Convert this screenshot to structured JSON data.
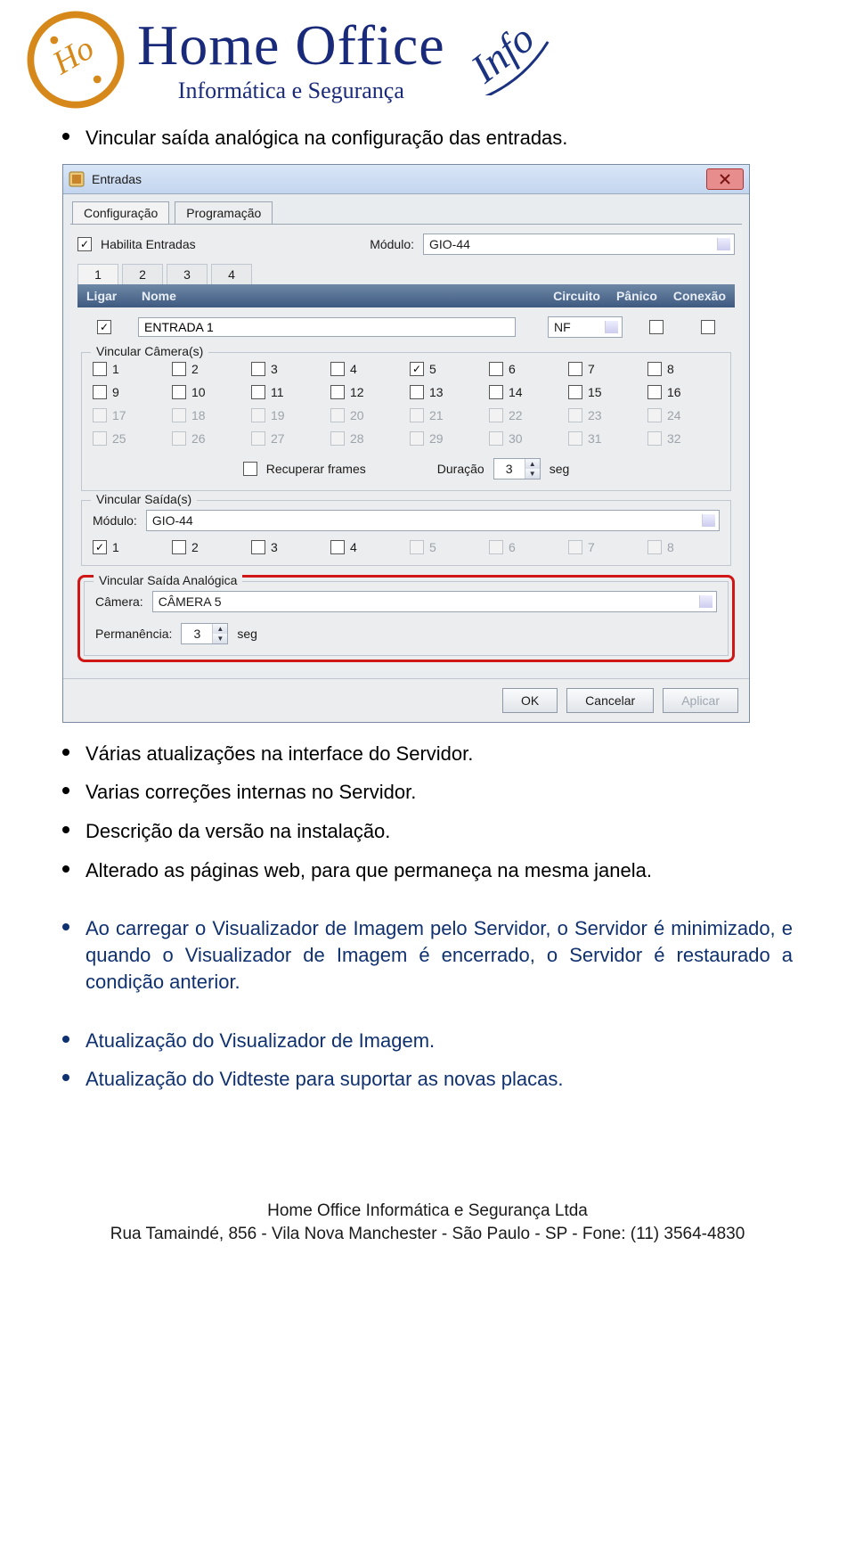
{
  "brand": {
    "main": "Home Office",
    "sub": "Informática e Segurança",
    "script": "Info"
  },
  "bullets": {
    "b0": "Vincular saída analógica na configuração das entradas.",
    "b1": "Várias atualizações na interface do Servidor.",
    "b2": "Varias correções internas no Servidor.",
    "b3": "Descrição da versão na instalação.",
    "b4": "Alterado as páginas web, para que permaneça na mesma janela.",
    "b5": "Ao carregar o Visualizador de Imagem pelo Servidor, o Servidor é minimizado, e quando o Visualizador de Imagem é encerrado, o Servidor é restaurado a condição anterior.",
    "b6": "Atualização do Visualizador de Imagem.",
    "b7": "Atualização do Vidteste para suportar as novas placas."
  },
  "win": {
    "title": "Entradas",
    "tabs": {
      "config": "Configuração",
      "prog": "Programação"
    },
    "habilita": "Habilita Entradas",
    "modulo_label": "Módulo:",
    "modulo_value": "GIO-44",
    "small_tabs": [
      "1",
      "2",
      "3",
      "4"
    ],
    "cols": {
      "ligar": "Ligar",
      "nome": "Nome",
      "circuito": "Circuito",
      "panico": "Pânico",
      "conexao": "Conexão"
    },
    "entry_name": "ENTRADA 1",
    "nf": "NF",
    "vcam": {
      "legend": "Vincular Câmera(s)",
      "nums": [
        "1",
        "2",
        "3",
        "4",
        "5",
        "6",
        "7",
        "8",
        "9",
        "10",
        "11",
        "12",
        "13",
        "14",
        "15",
        "16",
        "17",
        "18",
        "19",
        "20",
        "21",
        "22",
        "23",
        "24",
        "25",
        "26",
        "27",
        "28",
        "29",
        "30",
        "31",
        "32"
      ],
      "checked5": true
    },
    "recuperar": "Recuperar frames",
    "duracao_label": "Duração",
    "duracao_val": "3",
    "seg": "seg",
    "vsaida": {
      "legend": "Vincular Saída(s)",
      "modulo_label": "Módulo:",
      "modulo_value": "GIO-44",
      "nums": [
        "1",
        "2",
        "3",
        "4",
        "5",
        "6",
        "7",
        "8"
      ]
    },
    "vanalog": {
      "legend": "Vincular Saída Analógica",
      "cam_label": "Câmera:",
      "cam_value": "CÂMERA 5",
      "perm_label": "Permanência:",
      "perm_val": "3",
      "seg": "seg"
    },
    "buttons": {
      "ok": "OK",
      "cancel": "Cancelar",
      "apply": "Aplicar"
    }
  },
  "footer": {
    "line1": "Home Office Informática e Segurança Ltda",
    "line2": "Rua Tamaindé, 856   -   Vila Nova Manchester   -   São Paulo   -   SP   -   Fone: (11) 3564-4830"
  }
}
